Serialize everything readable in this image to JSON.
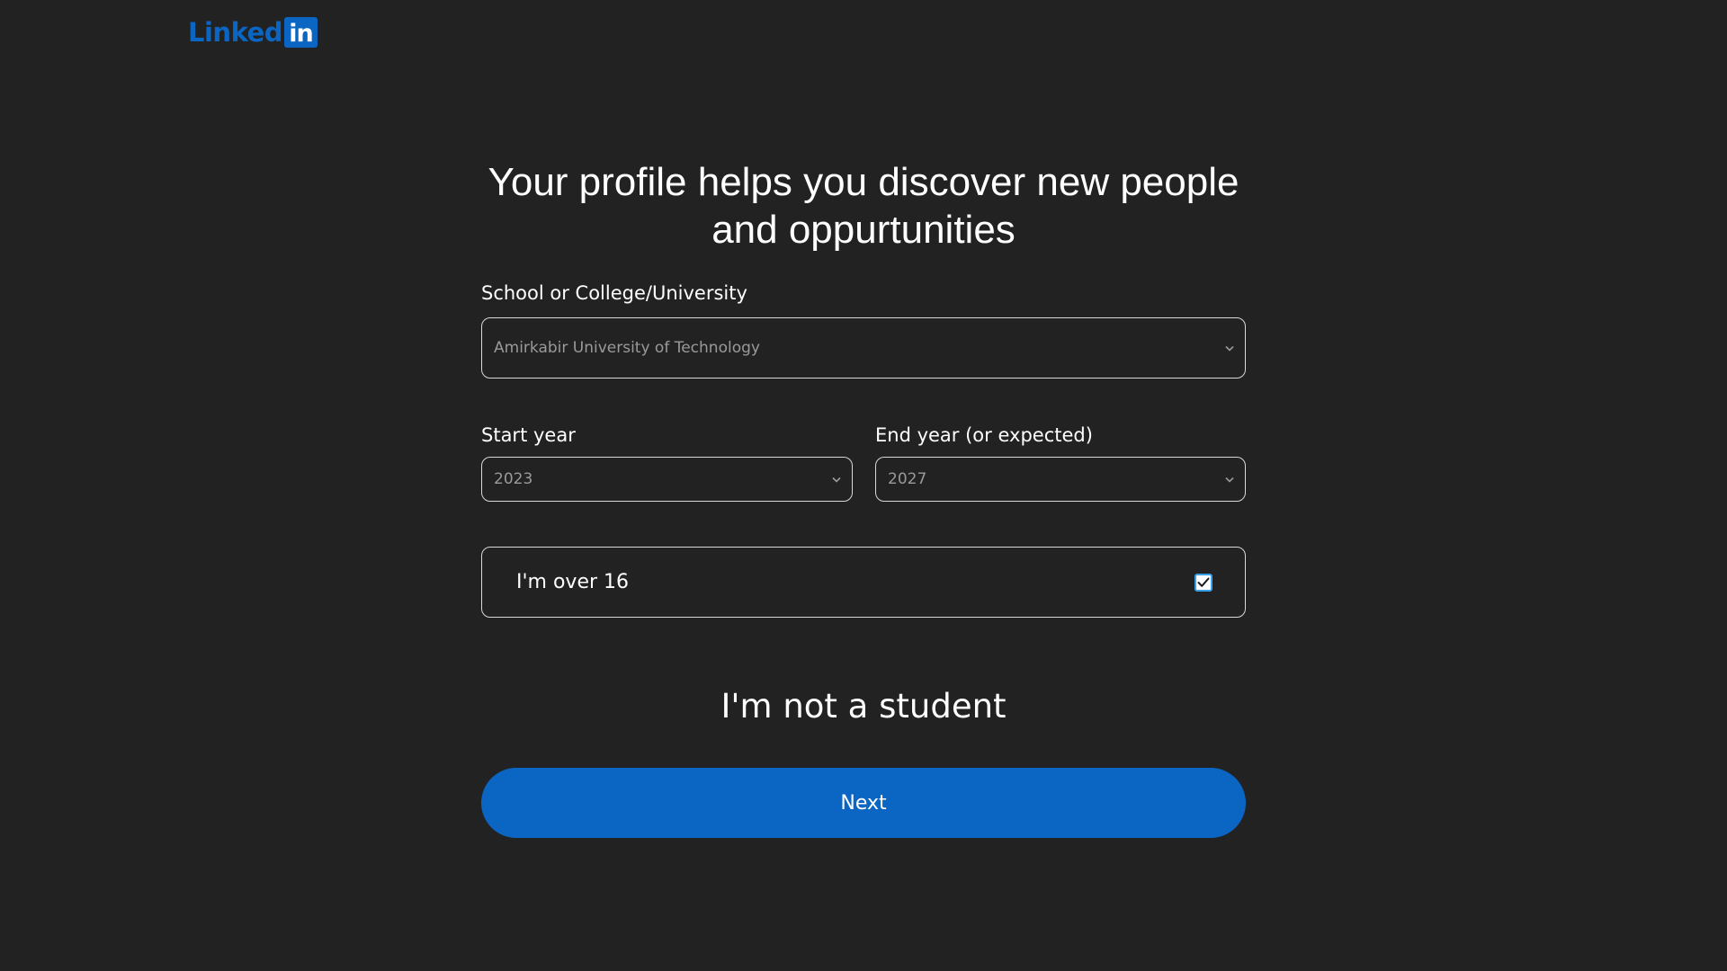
{
  "logo": {
    "text": "Linked",
    "box_text": "in",
    "brand_color": "#0a66c2"
  },
  "title": {
    "line1": "Your profile helps you discover new people",
    "line2": "and oppurtunities"
  },
  "school": {
    "label": "School or College/University",
    "value": "Amirkabir University of Technology",
    "icon": "chevron-down-icon"
  },
  "start_year": {
    "label": "Start year",
    "value": "2023",
    "icon": "chevron-down-icon"
  },
  "end_year": {
    "label": "End year (or expected)",
    "value": "2027",
    "icon": "chevron-down-icon"
  },
  "age_check": {
    "label": "I'm over 16",
    "checked": true
  },
  "not_student_label": "I'm not a student",
  "next_label": "Next",
  "colors": {
    "background": "#222222",
    "accent": "#0a66c2",
    "checkbox_border": "#3aa0e8"
  }
}
